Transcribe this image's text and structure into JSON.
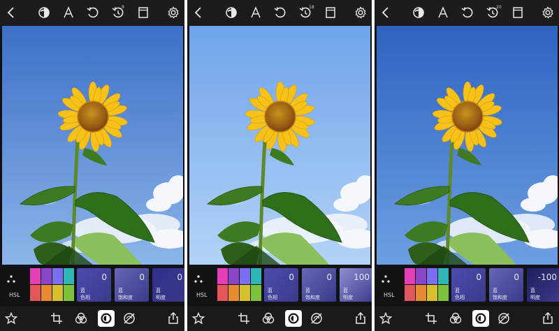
{
  "panels": [
    {
      "history_count": "9",
      "hsl": {
        "label": "HSL"
      },
      "tiles": [
        {
          "value": "0",
          "channel": "蓝",
          "param": "色相",
          "color": "#4c4cb0"
        },
        {
          "value": "0",
          "channel": "蓝",
          "param": "饱和度",
          "color": "#6566b6"
        },
        {
          "value": "0",
          "channel": "蓝",
          "param": "明度",
          "color": "#2f2f8c"
        }
      ],
      "sky_top": "#3c6fc6",
      "sky_bottom": "#8cb5ea"
    },
    {
      "history_count": "18",
      "hsl": {
        "label": "HSL"
      },
      "tiles": [
        {
          "value": "0",
          "channel": "蓝",
          "param": "色相",
          "color": "#4c4cb0"
        },
        {
          "value": "0",
          "channel": "蓝",
          "param": "饱和度",
          "color": "#6566b6"
        },
        {
          "value": "100",
          "channel": "蓝",
          "param": "明度",
          "color": "#8f8fd4"
        }
      ],
      "sky_top": "#6fa3ea",
      "sky_bottom": "#b3d3f7"
    },
    {
      "history_count": "20",
      "hsl": {
        "label": "HSL"
      },
      "tiles": [
        {
          "value": "0",
          "channel": "蓝",
          "param": "色相",
          "color": "#4c4cb0"
        },
        {
          "value": "0",
          "channel": "蓝",
          "param": "饱和度",
          "color": "#6566b6"
        },
        {
          "value": "-100",
          "channel": "蓝",
          "param": "明度",
          "color": "#1f1f5e"
        }
      ],
      "sky_top": "#2e62c0",
      "sky_bottom": "#6f9fe2"
    }
  ],
  "icons": {
    "top": [
      "back-icon",
      "mask-icon",
      "text-icon",
      "undo-icon",
      "history-icon",
      "compare-icon",
      "settings-icon"
    ],
    "bottom": [
      "favorite-icon",
      "crop-icon",
      "blend-icon",
      "adjust-icon",
      "hsl-icon",
      "export-icon"
    ]
  },
  "colors": {
    "toolbar": "#1c1c1e",
    "accent": "#ffffff",
    "swatches": [
      "#e53fb8",
      "#8b46c8",
      "#7a6ff0",
      "#2fb4b8",
      "#e4575a",
      "#e88a32",
      "#d7c02c",
      "#7cc23a"
    ]
  }
}
